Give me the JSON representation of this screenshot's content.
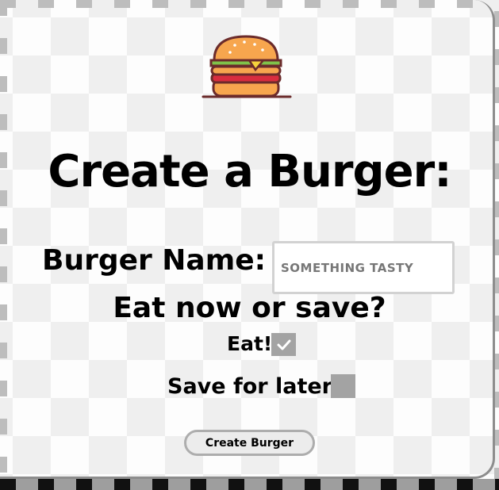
{
  "header": {
    "logo_icon": "burger-icon",
    "title": "Create a Burger:"
  },
  "form": {
    "name_label": "Burger Name:",
    "name_placeholder": "SOMETHING TASTY",
    "name_value": "",
    "question": "Eat now or save?",
    "eat_label": "Eat!",
    "eat_checked": true,
    "save_label": "Save for later",
    "save_checked": false,
    "submit_label": "Create Burger"
  },
  "colors": {
    "checkbox_fill": "#a3a3a3",
    "bun": "#f7a64e",
    "lettuce": "#7fc34a",
    "cheese": "#f5d23c",
    "patty": "#d92d3f",
    "outline": "#6b2b2b"
  }
}
